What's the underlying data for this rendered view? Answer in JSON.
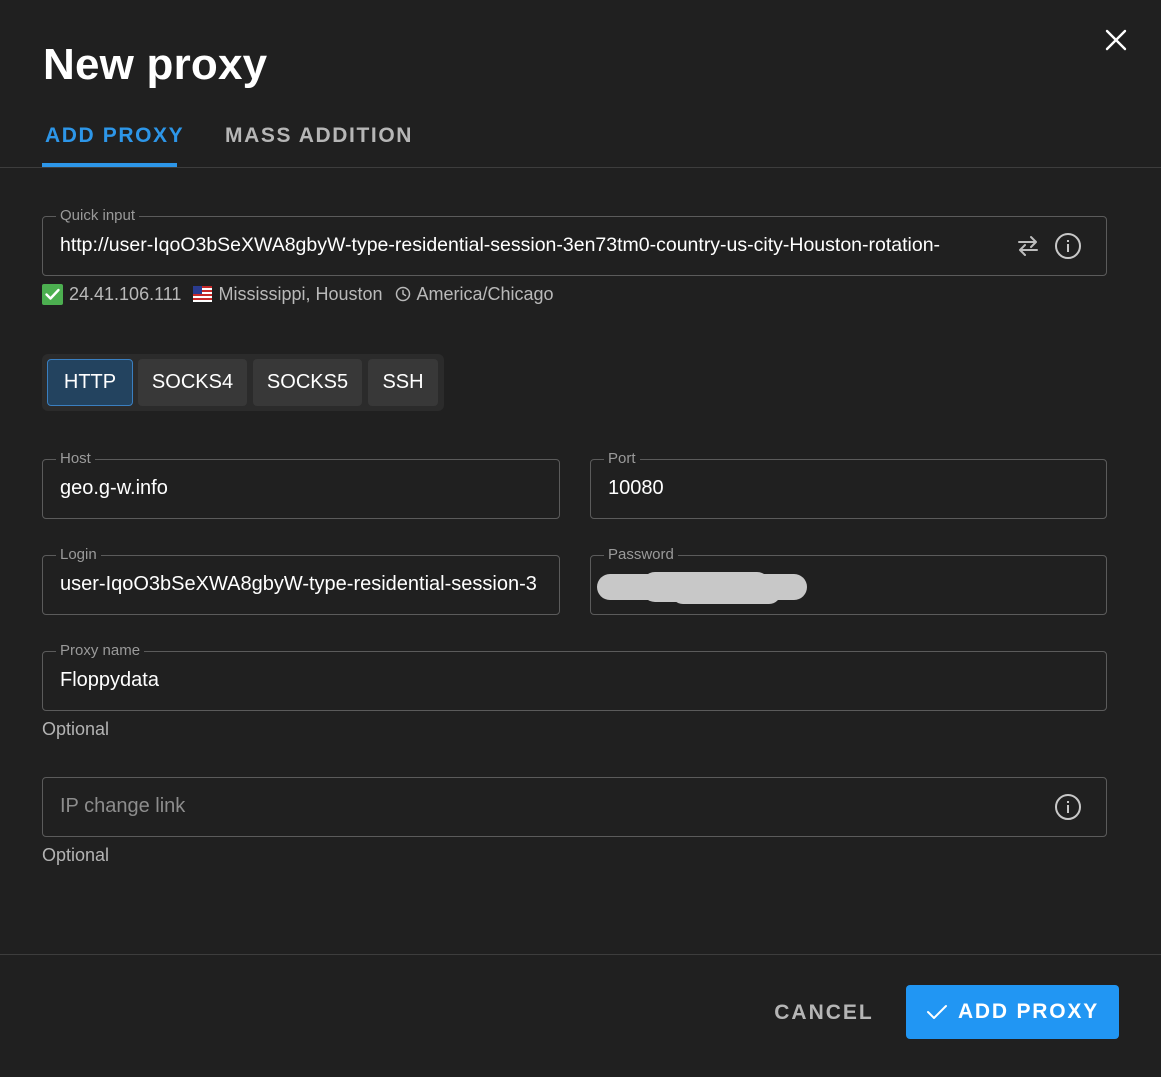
{
  "dialog": {
    "title": "New proxy"
  },
  "tabs": [
    {
      "label": "ADD PROXY",
      "active": true
    },
    {
      "label": "MASS ADDITION",
      "active": false
    }
  ],
  "quick_input": {
    "label": "Quick input",
    "value": "http://user-IqoO3bSeXWA8gbyW-type-residential-session-3en73tm0-country-us-city-Houston-rotation-"
  },
  "ip_info": {
    "ip": "24.41.106.111",
    "location": "Mississippi, Houston",
    "timezone": "America/Chicago"
  },
  "protocols": [
    {
      "label": "HTTP",
      "active": true
    },
    {
      "label": "SOCKS4",
      "active": false
    },
    {
      "label": "SOCKS5",
      "active": false
    },
    {
      "label": "SSH",
      "active": false
    }
  ],
  "host": {
    "label": "Host",
    "value": "geo.g-w.info"
  },
  "port": {
    "label": "Port",
    "value": "10080"
  },
  "login": {
    "label": "Login",
    "value": "user-IqoO3bSeXWA8gbyW-type-residential-session-3"
  },
  "password": {
    "label": "Password"
  },
  "proxy_name": {
    "label": "Proxy name",
    "value": "Floppydata",
    "hint": "Optional"
  },
  "ip_change_link": {
    "placeholder": "IP change link",
    "hint": "Optional"
  },
  "footer": {
    "cancel_label": "CANCEL",
    "add_label": "ADD PROXY"
  },
  "colors": {
    "accent": "#2196f3",
    "tab_active": "#2d96e8",
    "check_green": "#4caf50",
    "background": "#202020"
  }
}
